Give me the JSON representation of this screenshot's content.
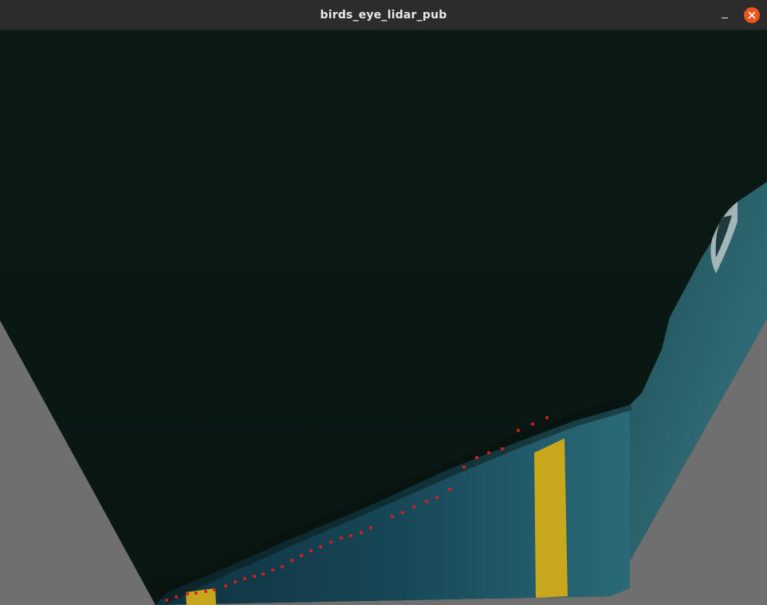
{
  "window": {
    "title": "birds_eye_lidar_pub"
  },
  "controls": {
    "minimize": "minimize",
    "close": "close"
  },
  "icons": {
    "minimize": "minimize-icon",
    "close": "close-icon"
  },
  "colors": {
    "titlebar": "#2c2c2c",
    "close_button": "#e9541f",
    "background_outside_warp": "#6f6f6f",
    "dark_area": "#0b1814",
    "floor": "#1f5060",
    "lane_marking": "#c9a81e",
    "lidar_points": "#e01b1b"
  }
}
